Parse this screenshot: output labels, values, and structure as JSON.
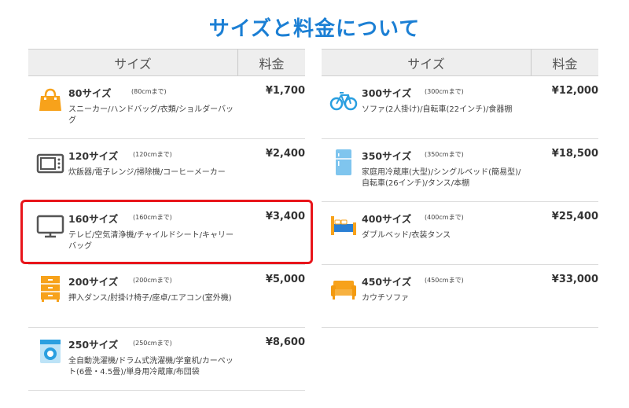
{
  "title": "サイズと料金について",
  "headers": {
    "size": "サイズ",
    "price": "料金"
  },
  "left_items": [
    {
      "icon": "handbag-icon",
      "name": "80サイズ",
      "size": "(80cmまで)",
      "desc": "スニーカー/ハンドバッグ/衣類/ショルダーバッグ",
      "price": "¥1,700"
    },
    {
      "icon": "microwave-icon",
      "name": "120サイズ",
      "size": "(120cmまで)",
      "desc": "炊飯器/電子レンジ/掃除機/コーヒーメーカー",
      "price": "¥2,400"
    },
    {
      "icon": "tv-icon",
      "name": "160サイズ",
      "size": "(160cmまで)",
      "desc": "テレビ/空気清浄機/チャイルドシート/キャリーバッグ",
      "price": "¥3,400"
    },
    {
      "icon": "drawer-chest-icon",
      "name": "200サイズ",
      "size": "(200cmまで)",
      "desc": "押入ダンス/肘掛け椅子/座卓/エアコン(室外機)",
      "price": "¥5,000"
    },
    {
      "icon": "washing-machine-icon",
      "name": "250サイズ",
      "size": "(250cmまで)",
      "desc": "全自動洗濯機/ドラム式洗濯機/学童机/カーペット(6畳・4.5畳)/単身用冷蔵庫/布団袋",
      "price": "¥8,600"
    }
  ],
  "right_items": [
    {
      "icon": "bicycle-icon",
      "name": "300サイズ",
      "size": "(300cmまで)",
      "desc": "ソファ(2人掛け)/自転車(22インチ)/食器棚",
      "price": "¥12,000"
    },
    {
      "icon": "refrigerator-icon",
      "name": "350サイズ",
      "size": "(350cmまで)",
      "desc": "家庭用冷蔵庫(大型)/シングルベッド(簡易型)/自転車(26インチ)/タンス/本棚",
      "price": "¥18,500"
    },
    {
      "icon": "bed-icon",
      "name": "400サイズ",
      "size": "(400cmまで)",
      "desc": "ダブルベッド/衣装タンス",
      "price": "¥25,400"
    },
    {
      "icon": "sofa-icon",
      "name": "450サイズ",
      "size": "(450cmまで)",
      "desc": "カウチソファ",
      "price": "¥33,000"
    }
  ],
  "colors": {
    "title": "#1b7fd4",
    "highlight": "#e8151b",
    "icon_orange": "#f7a21b",
    "icon_blue": "#2a9fe0"
  }
}
